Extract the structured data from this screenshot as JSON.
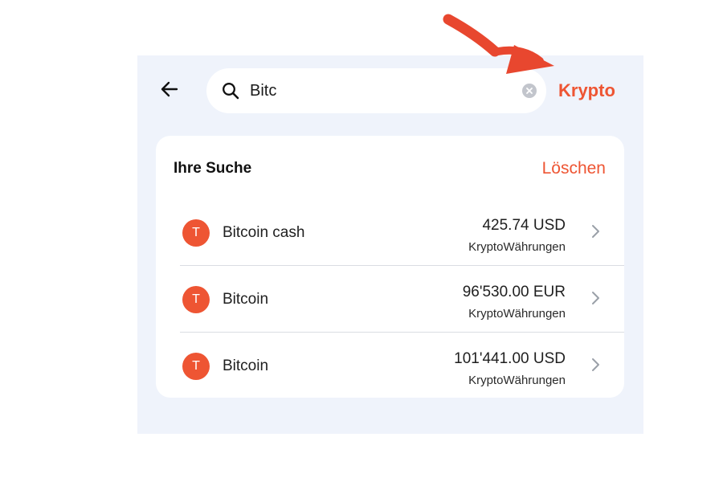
{
  "header": {
    "back_icon": "arrow-left-icon",
    "search": {
      "icon": "search-icon",
      "value": "Bitc",
      "clear_icon": "clear-circle-icon"
    },
    "active_tab_label": "Krypto"
  },
  "search_history": {
    "title": "Ihre Suche",
    "clear_label": "Löschen",
    "results": [
      {
        "badge": "T",
        "name": "Bitcoin cash",
        "price": "425.74 USD",
        "category": "KryptoWährungen",
        "chevron_icon": "chevron-right-icon"
      },
      {
        "badge": "T",
        "name": "Bitcoin",
        "price": "96'530.00 EUR",
        "category": "KryptoWährungen",
        "chevron_icon": "chevron-right-icon"
      },
      {
        "badge": "T",
        "name": "Bitcoin",
        "price": "101'441.00 USD",
        "category": "KryptoWährungen",
        "chevron_icon": "chevron-right-icon"
      }
    ]
  },
  "annotation": {
    "icon": "red-arrow-icon"
  },
  "colors": {
    "accent": "#ee5533",
    "panel_background": "#eff3fb",
    "card_background": "#ffffff",
    "divider": "#dadde3",
    "annotation_arrow": "#e8472f"
  }
}
